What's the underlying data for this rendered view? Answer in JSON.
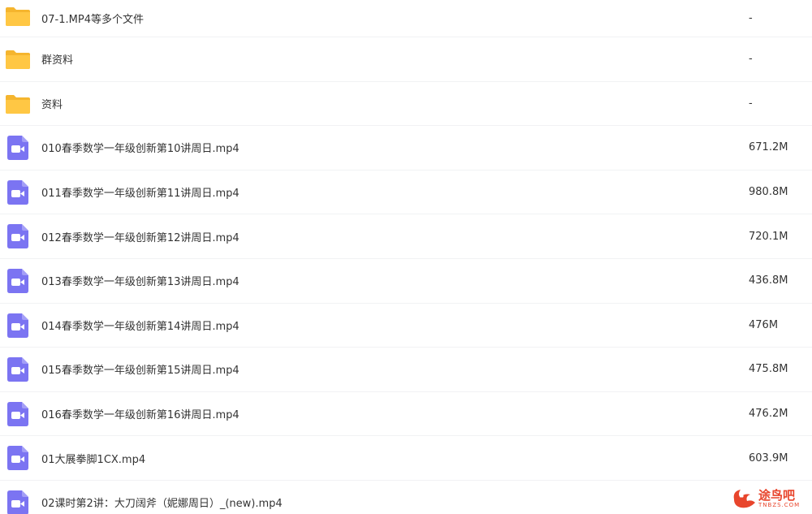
{
  "files": [
    {
      "type": "folder",
      "name": "07-1.MP4等多个文件",
      "size": "-"
    },
    {
      "type": "folder",
      "name": "群资料",
      "size": "-"
    },
    {
      "type": "folder",
      "name": "资料",
      "size": "-"
    },
    {
      "type": "video",
      "name": "010春季数学一年级创新第10讲周日.mp4",
      "size": "671.2M"
    },
    {
      "type": "video",
      "name": "011春季数学一年级创新第11讲周日.mp4",
      "size": "980.8M"
    },
    {
      "type": "video",
      "name": "012春季数学一年级创新第12讲周日.mp4",
      "size": "720.1M"
    },
    {
      "type": "video",
      "name": "013春季数学一年级创新第13讲周日.mp4",
      "size": "436.8M"
    },
    {
      "type": "video",
      "name": "014春季数学一年级创新第14讲周日.mp4",
      "size": "476M"
    },
    {
      "type": "video",
      "name": "015春季数学一年级创新第15讲周日.mp4",
      "size": "475.8M"
    },
    {
      "type": "video",
      "name": "016春季数学一年级创新第16讲周日.mp4",
      "size": "476.2M"
    },
    {
      "type": "video",
      "name": "01大展拳脚1CX.mp4",
      "size": "603.9M"
    },
    {
      "type": "video",
      "name": "02课时第2讲：大刀阔斧（妮娜周日）_(new).mp4",
      "size": ""
    }
  ],
  "watermark": {
    "text": "途鸟吧",
    "sub": "TNBZS.COM"
  },
  "colors": {
    "folder": "#ffc744",
    "folder_tab": "#f5b52e",
    "video": "#7b74f2"
  }
}
